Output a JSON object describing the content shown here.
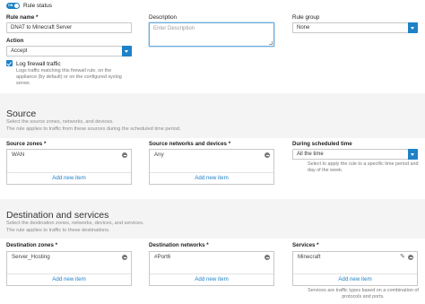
{
  "rule_status": {
    "label": "Rule status",
    "on_text": "ON"
  },
  "rule_name": {
    "label": "Rule name *",
    "value": "DNAT to Minecraft Server"
  },
  "description": {
    "label": "Description",
    "placeholder": "Enter Description"
  },
  "rule_group": {
    "label": "Rule group",
    "value": "None"
  },
  "action": {
    "label": "Action",
    "value": "Accept"
  },
  "log_traffic": {
    "label": "Log firewall traffic",
    "help": "Logs traffic matching this firewall rule, on the appliance (by default) or on the configured syslog server."
  },
  "source": {
    "title": "Source",
    "subtitle1": "Select the source zones, networks, and devices.",
    "subtitle2": "The rule applies to traffic from these sources during the scheduled time period.",
    "zones_label": "Source zones *",
    "zones_value": "WAN",
    "networks_label": "Source networks and devices *",
    "networks_value": "Any",
    "add_label": "Add new item",
    "schedule_label": "During scheduled time",
    "schedule_value": "All the time",
    "schedule_help": "Select to apply the rule to a specific time period and day of the week."
  },
  "destination": {
    "title": "Destination and services",
    "subtitle1": "Select the destination zones, networks, devices, and services.",
    "subtitle2": "The rule applies to traffic to these destinations.",
    "zones_label": "Destination zones *",
    "zones_value": "Server_Hosting",
    "networks_label": "Destination networks *",
    "networks_value": "#Port6",
    "services_label": "Services *",
    "services_value": "Minecraft",
    "add_label": "Add new item",
    "services_help": "Services are traffic types based on a combination of protocols and ports."
  },
  "colors": {
    "accent": "#1d82c7",
    "band": "#f4f4f4"
  }
}
